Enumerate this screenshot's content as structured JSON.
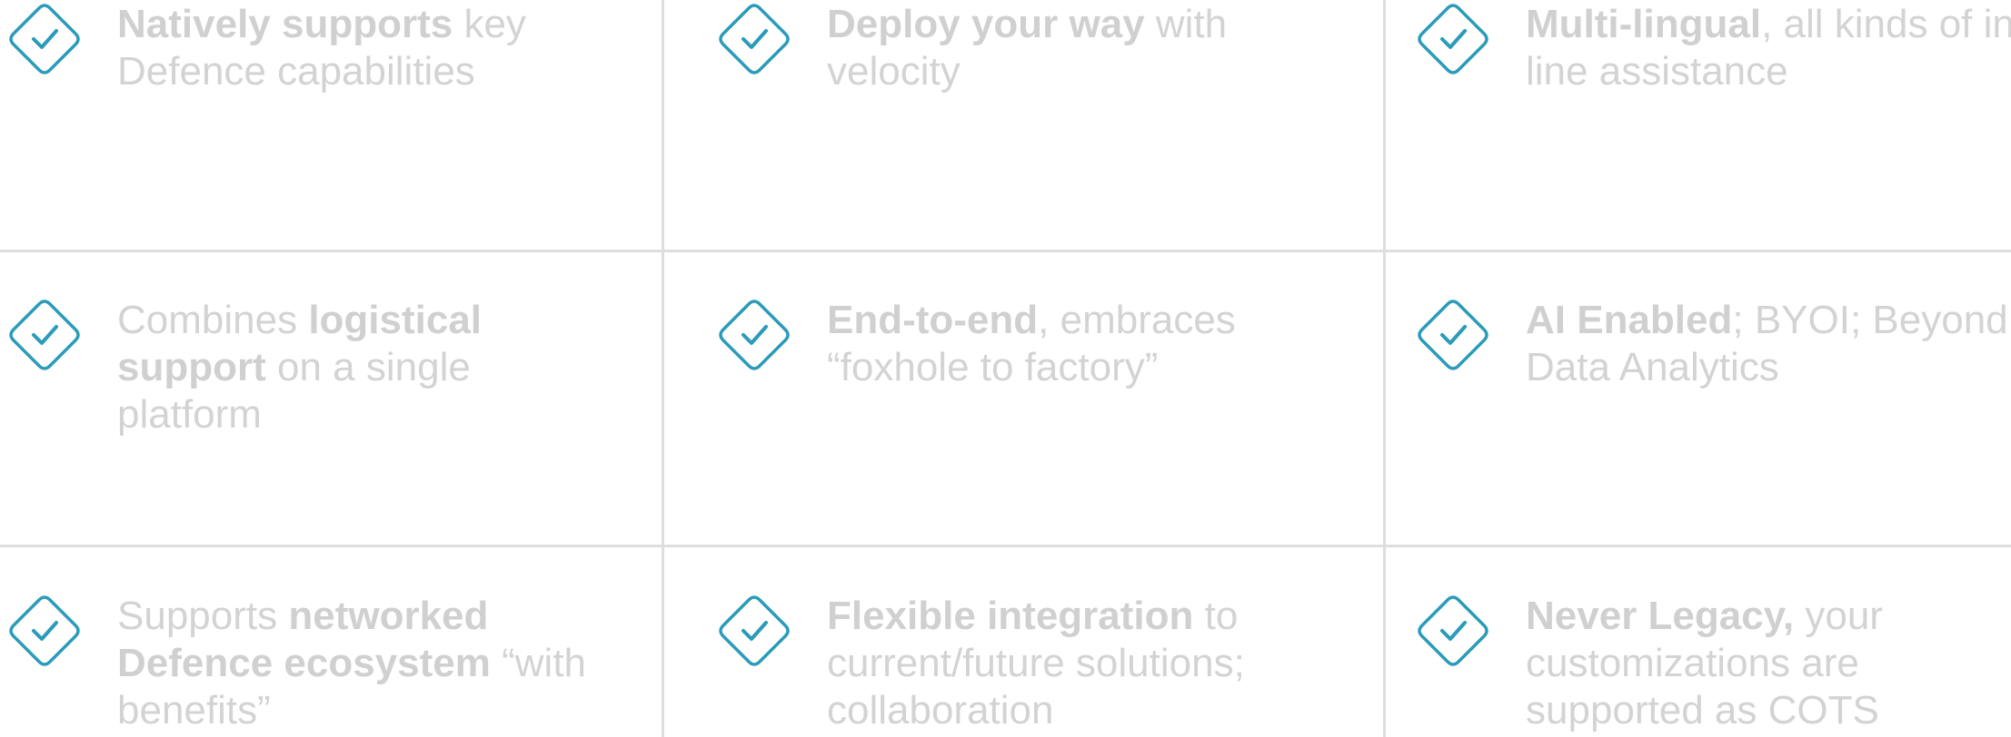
{
  "accent_color": "#2a9bb8",
  "text_color": "#d3d3d3",
  "divider_color": "#dedede",
  "icon": "check-diamond-icon",
  "cells": [
    {
      "pre": "",
      "bold": "Natively supports",
      "post": " key Defence capabilities"
    },
    {
      "pre": "",
      "bold": "Deploy your way",
      "post": " with velocity"
    },
    {
      "pre": "",
      "bold": "Multi-lingual",
      "post": ", all kinds of in-line assistance"
    },
    {
      "pre": "Combines ",
      "bold": "logistical support",
      "post": " on a single platform"
    },
    {
      "pre": "",
      "bold": "End-to-end",
      "post": ", embraces “foxhole to factory”"
    },
    {
      "pre": "",
      "bold": "AI Enabled",
      "post": "; BYOI; Beyond Data Analytics"
    },
    {
      "pre": "Supports ",
      "bold": "networked Defence ecosystem",
      "post": " “with benefits”"
    },
    {
      "pre": "",
      "bold": "Flexible integration",
      "post": " to current/future solutions; collaboration"
    },
    {
      "pre": "",
      "bold": "Never Legacy,",
      "post": " your customizations are supported as COTS"
    }
  ]
}
